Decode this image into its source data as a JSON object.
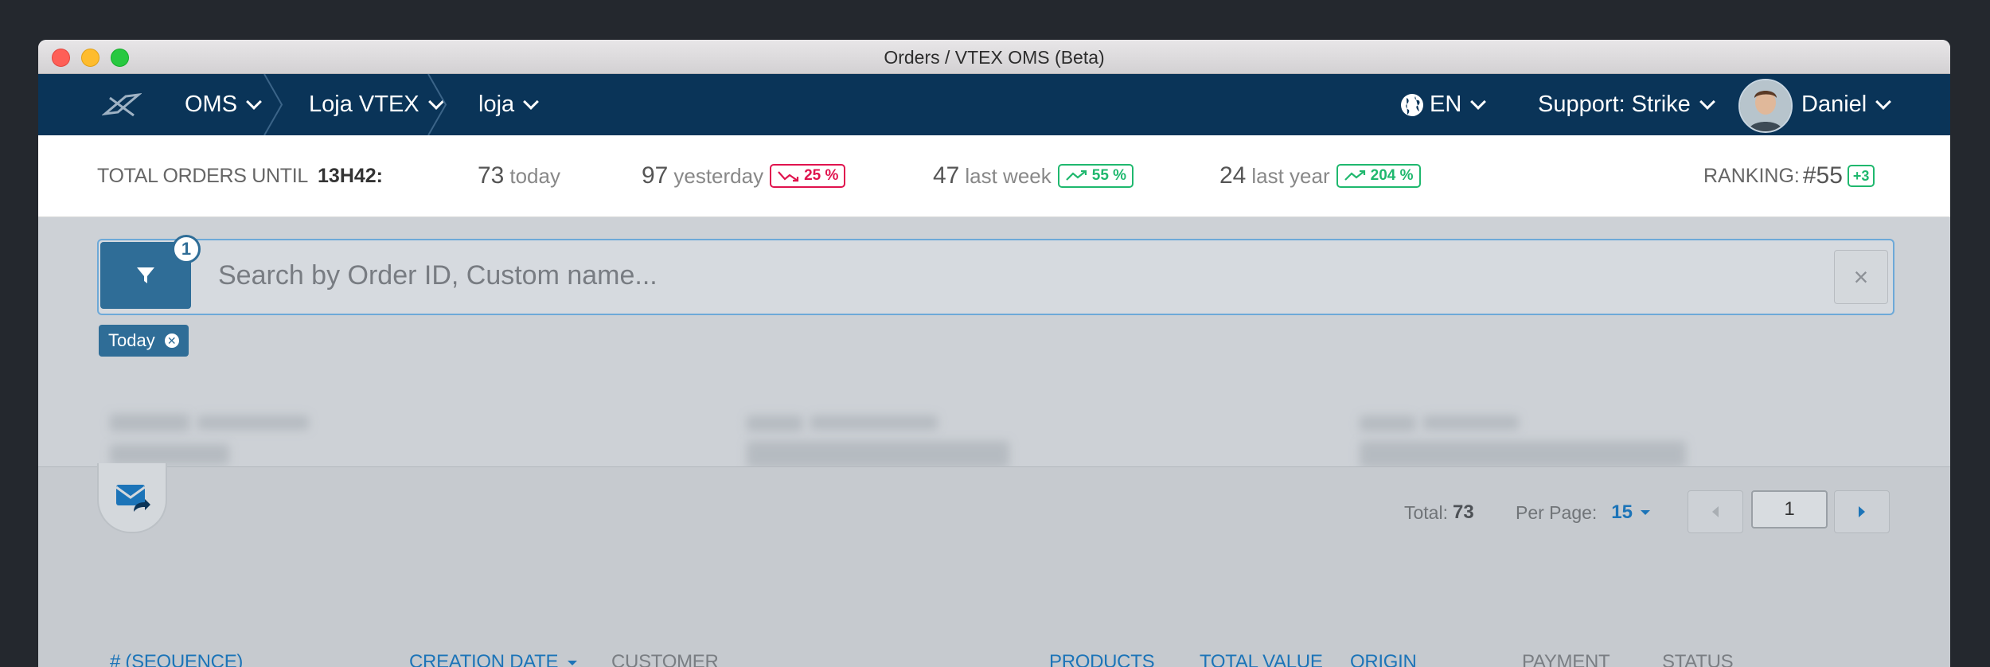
{
  "window": {
    "title": "Orders / VTEX OMS (Beta)"
  },
  "nav": {
    "module": "OMS",
    "store": "Loja VTEX",
    "account": "loja",
    "language": "EN",
    "support": "Support: Strike",
    "user": "Daniel"
  },
  "stats": {
    "label": "TOTAL ORDERS UNTIL",
    "time": "13H42:",
    "today": {
      "count": "73",
      "unit": "today"
    },
    "yesterday": {
      "count": "97",
      "unit": "yesterday",
      "change": "25 %",
      "trend": "down"
    },
    "last_week": {
      "count": "47",
      "unit": "last week",
      "change": "55 %",
      "trend": "up"
    },
    "last_year": {
      "count": "24",
      "unit": "last year",
      "change": "204 %",
      "trend": "up"
    },
    "ranking_label": "RANKING:",
    "ranking_value": "#55",
    "ranking_change": "+3"
  },
  "search": {
    "placeholder": "Search by Order ID, Custom name...",
    "filter_count": "1",
    "clear": "×",
    "active_tag": "Today"
  },
  "pagination": {
    "total_label": "Total:",
    "total_value": "73",
    "per_page_label": "Per Page:",
    "per_page_value": "15",
    "current_page": "1"
  },
  "table": {
    "columns": [
      "# (SEQUENCE)",
      "CREATION DATE",
      "CUSTOMER",
      "PRODUCTS",
      "TOTAL VALUE",
      "ORIGIN",
      "PAYMENT",
      "STATUS"
    ]
  },
  "colors": {
    "navbar": "#0a3458",
    "accent_blue": "#1c74b8",
    "filter_button": "#2f6d97",
    "trend_down": "#e0134e",
    "trend_up": "#1fb86e"
  }
}
